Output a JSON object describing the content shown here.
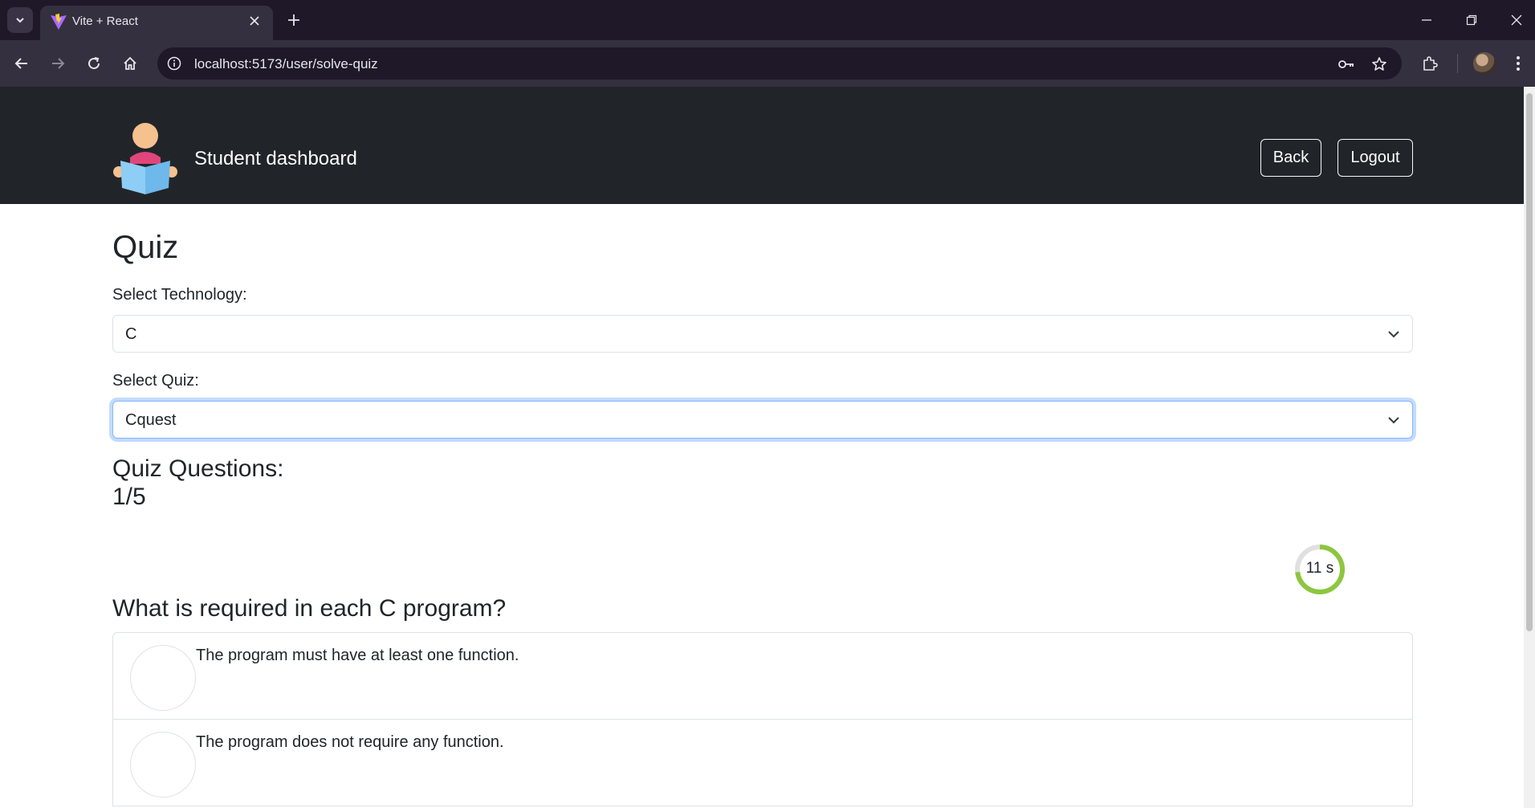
{
  "browser": {
    "tab_title": "Vite + React",
    "url": "localhost:5173/user/solve-quiz"
  },
  "header": {
    "brand": "Student dashboard",
    "back_label": "Back",
    "logout_label": "Logout"
  },
  "page": {
    "title": "Quiz",
    "technology_label": "Select Technology:",
    "technology_value": "C",
    "quiz_label": "Select Quiz:",
    "quiz_value": "Cquest",
    "questions_heading": "Quiz Questions:",
    "progress": "1/5",
    "timer": {
      "text": "11 s",
      "remaining_fraction": 0.73,
      "color": "#8dc63f"
    },
    "question": "What is required in each C program?",
    "options": [
      "The program must have at least one function.",
      "The program does not require any function."
    ]
  }
}
